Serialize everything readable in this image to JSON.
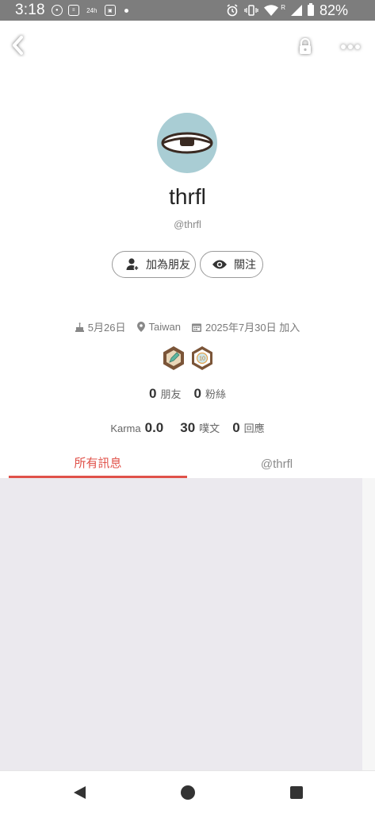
{
  "status_bar": {
    "time": "3:18",
    "battery": "82%",
    "icons": [
      "line-icon",
      "news-icon",
      "24h-icon",
      "screenshot-icon",
      "dot",
      "alarm-icon",
      "vibrate-icon",
      "wifi-icon",
      "signal-icon",
      "battery-icon"
    ],
    "badge_24h": "24h",
    "roaming": "R"
  },
  "header": {
    "icons": [
      "back-chevron-icon",
      "lock-icon",
      "more-dots-icon"
    ]
  },
  "profile": {
    "display_name": "thrfl",
    "username": "@thrfl",
    "avatar_color": "#a9cdd4"
  },
  "actions": {
    "add_friend": "加為朋友",
    "follow": "關注"
  },
  "meta": {
    "birthday": "5月26日",
    "location": "Taiwan",
    "joined": "2025年7月30日 加入"
  },
  "badges": [
    {
      "name": "pencil-badge",
      "colors": [
        "#7b5538",
        "#5bb7a0"
      ]
    },
    {
      "name": "ten-badge",
      "label": "10",
      "colors": [
        "#7b5538",
        "#e9d7b9"
      ]
    }
  ],
  "stats": {
    "friends_count": "0",
    "friends_label": "朋友",
    "fans_count": "0",
    "fans_label": "粉絲",
    "karma_label": "Karma",
    "karma_value": "0.0",
    "plurks_count": "30",
    "plurks_label": "噗文",
    "replies_count": "0",
    "replies_label": "回應"
  },
  "tabs": [
    {
      "label": "所有訊息",
      "active": true
    },
    {
      "label": "@thrfl",
      "active": false
    }
  ],
  "colors": {
    "accent": "#e0524a",
    "feed_bg": "#ebe9ee",
    "status_bar": "#7d7d7d"
  },
  "navbar": {
    "icons": [
      "back-triangle-icon",
      "home-circle-icon",
      "recents-square-icon"
    ]
  }
}
